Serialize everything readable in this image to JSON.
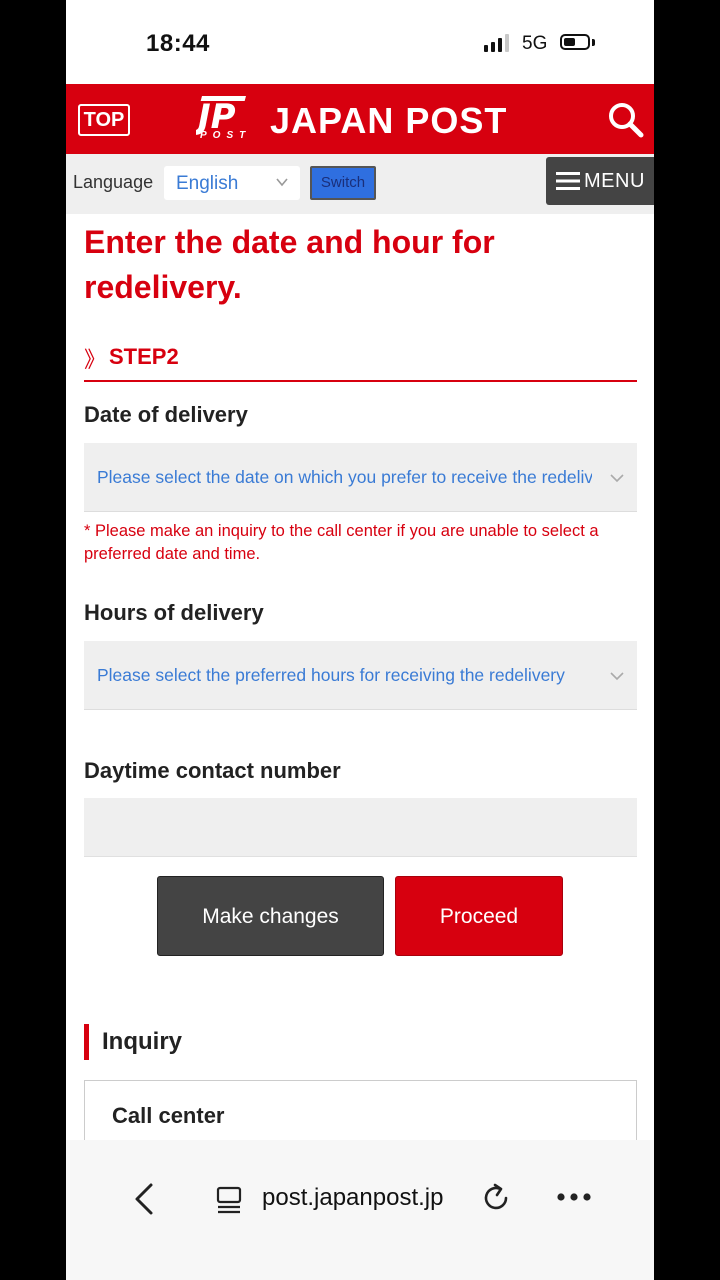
{
  "status_bar": {
    "time": "18:44",
    "network": "5G",
    "battery_level": 0.5,
    "signal_bars_active": 3
  },
  "header": {
    "top_label": "TOP",
    "logo_mark": "JP",
    "logo_sub": "POST",
    "logo_text": "JAPAN POST",
    "icons": {
      "search": "search-icon"
    },
    "brand_color": "#d7000f"
  },
  "language_bar": {
    "label": "Language",
    "selected": "English",
    "switch_label": "Switch",
    "menu_label": "MENU"
  },
  "main": {
    "title": "Enter the date and hour for redelivery.",
    "step": {
      "mark": "》",
      "label": "STEP2"
    },
    "date": {
      "label": "Date of delivery",
      "placeholder": "Please select the date on which you prefer to receive the redelivery"
    },
    "note": "* Please make an inquiry to the call center if you are unable to select a preferred date and time.",
    "hours": {
      "label": "Hours of delivery",
      "placeholder": "Please select the preferred hours for receiving the redelivery"
    },
    "contact": {
      "label": "Daytime contact number",
      "value": ""
    },
    "buttons": {
      "change": "Make changes",
      "proceed": "Proceed"
    },
    "inquiry": {
      "title": "Inquiry",
      "call_center": "Call center"
    }
  },
  "browser": {
    "url": "post.japanpost.jp",
    "icons": {
      "back": "chevron-left-icon",
      "tabs": "tabs-icon",
      "reload": "reload-icon",
      "more": "more-icon"
    }
  }
}
